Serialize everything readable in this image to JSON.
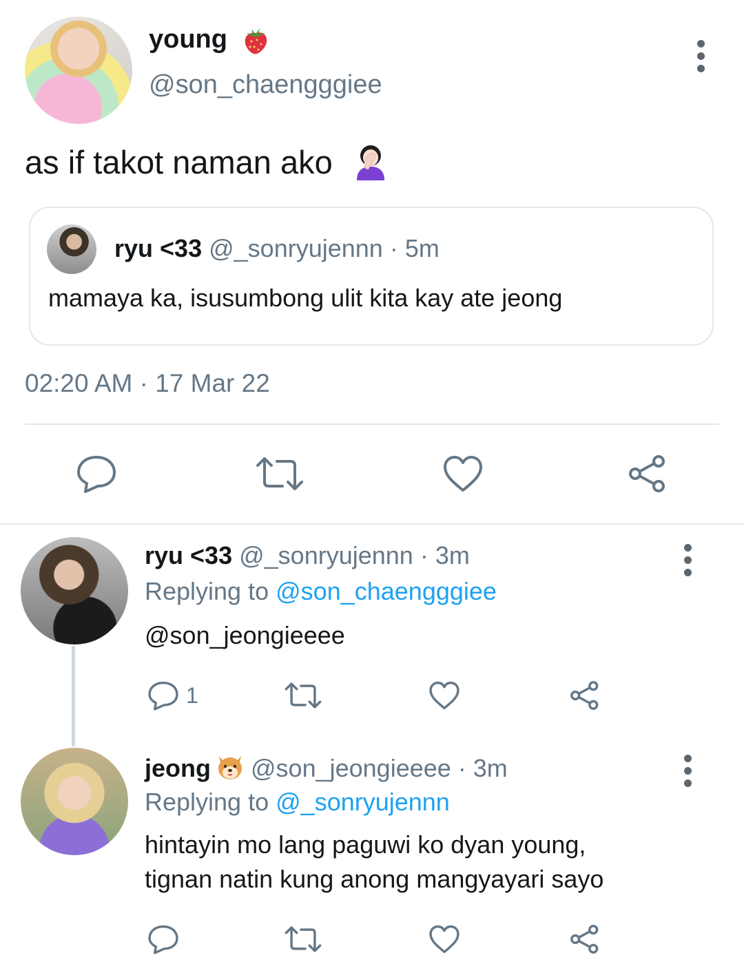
{
  "main_tweet": {
    "display_name": "young",
    "name_emoji": "strawberry-icon",
    "handle": "@son_chaengggiee",
    "text": "as if takot naman ako",
    "text_emoji": "person-facepalming-icon",
    "timestamp": "02:20 AM · 17 Mar 22",
    "quoted": {
      "display_name": "ryu <33",
      "handle": "@_sonryujennn",
      "time": "· 5m",
      "text": "mamaya ka, isusumbong ulit kita kay ate jeong"
    }
  },
  "actions": {
    "icons": [
      "reply-icon",
      "retweet-icon",
      "like-icon",
      "share-icon"
    ]
  },
  "replies": [
    {
      "display_name": "ryu <33",
      "handle": "@_sonryujennn",
      "time": "· 3m",
      "replying_label": "Replying to",
      "replying_to": "@son_chaengggiee",
      "text": "@son_jeongieeee",
      "reply_count": "1"
    },
    {
      "display_name": "jeong",
      "name_emoji": "dog-face-icon",
      "handle": "@son_jeongieeee",
      "time": "· 3m",
      "replying_label": "Replying to",
      "replying_to": "@_sonryujennn",
      "text_line1": "hintayin mo lang paguwi ko dyan young,",
      "text_line2": "tignan natin kung anong mangyayari sayo"
    }
  ],
  "colors": {
    "link": "#1da1f2",
    "muted": "#657786",
    "icon": "#657786"
  }
}
